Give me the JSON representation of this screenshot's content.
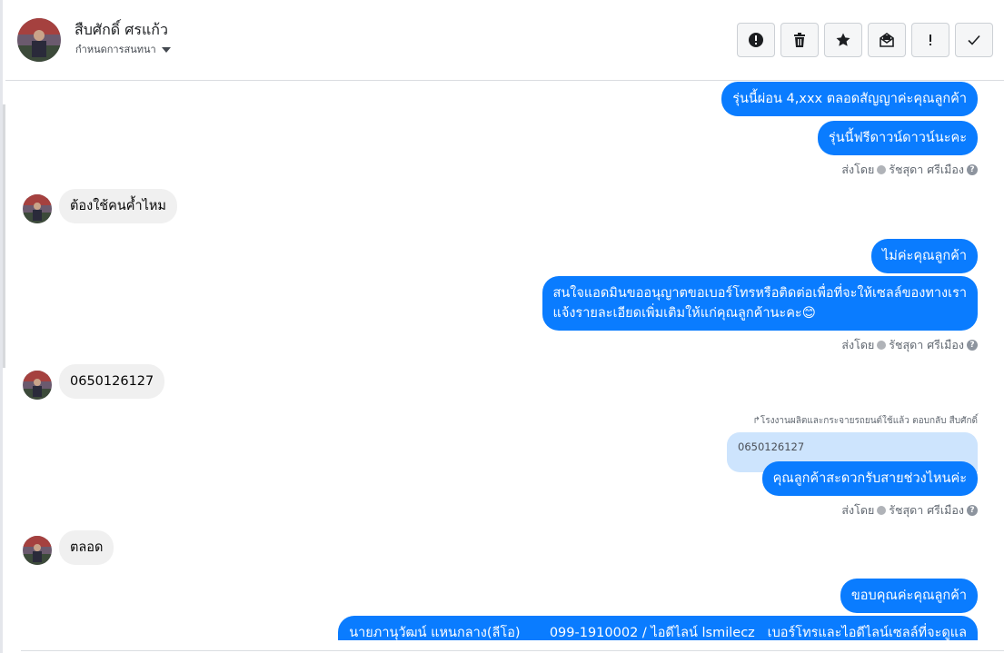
{
  "header": {
    "contact_name": "สืบศักดิ์ ศรแก้ว",
    "assign_label": "กำหนดการสนทนา",
    "actions": [
      {
        "icon": "alert-circle-icon"
      },
      {
        "icon": "trash-icon"
      },
      {
        "icon": "star-icon"
      },
      {
        "icon": "mark-unread-icon"
      },
      {
        "icon": "exclamation-icon"
      },
      {
        "icon": "checkmark-icon"
      }
    ]
  },
  "messages": {
    "out_1": "รุ่นนี้ผ่อน 4,xxx ตลอดสัญญาค่ะคุณลูกค้า",
    "out_2": "รุ่นนี้ฟรีดาวน์ดาวน์นะคะ",
    "sent_by_1": "ส่งโดย",
    "agent_1": "รัชสุดา ศรีเมือง",
    "in_1": "ต้องใช้คนค้ำไหม",
    "out_3": "ไม่ค่ะคุณลูกค้า",
    "out_4_line1": "สนใจแอดมินขออนุญาตขอเบอร์โทรหรือติดต่อเพื่อที่จะให้เซลล์ของทางเรา",
    "out_4_line2": "แจ้งรายละเอียดเพิ่มเติมให้แก่คุณลูกค้านะคะ😊",
    "sent_by_2": "ส่งโดย",
    "agent_2": "รัชสุดา ศรีเมือง",
    "in_2": "0650126127",
    "reply_note": "โรงงานผลิตและกระจายรถยนต์ใช้แล้ว ตอบกลับ สืบศักดิ์",
    "quoted_text": "0650126127",
    "out_5": "คุณลูกค้าสะดวกรับสายช่วงไหนค่ะ",
    "sent_by_3": "ส่งโดย",
    "agent_3": "รัชสุดา ศรีเมือง",
    "in_3": "ตลอด",
    "out_6": "ขอบคุณค่ะคุณลูกค้า",
    "out_7": "นายภานุวัฒน์ แหนกลาง(ลีโอ)       099-1910002 / ไอดีไลน์ lsmilecz   เบอร์โทรและไอดีไลน์เซลล์ที่จะดูแล"
  },
  "colors": {
    "outgoing_bubble": "#0a7cff",
    "incoming_bubble": "#f0f0f0",
    "quoted_bubble": "#cde4fd"
  }
}
